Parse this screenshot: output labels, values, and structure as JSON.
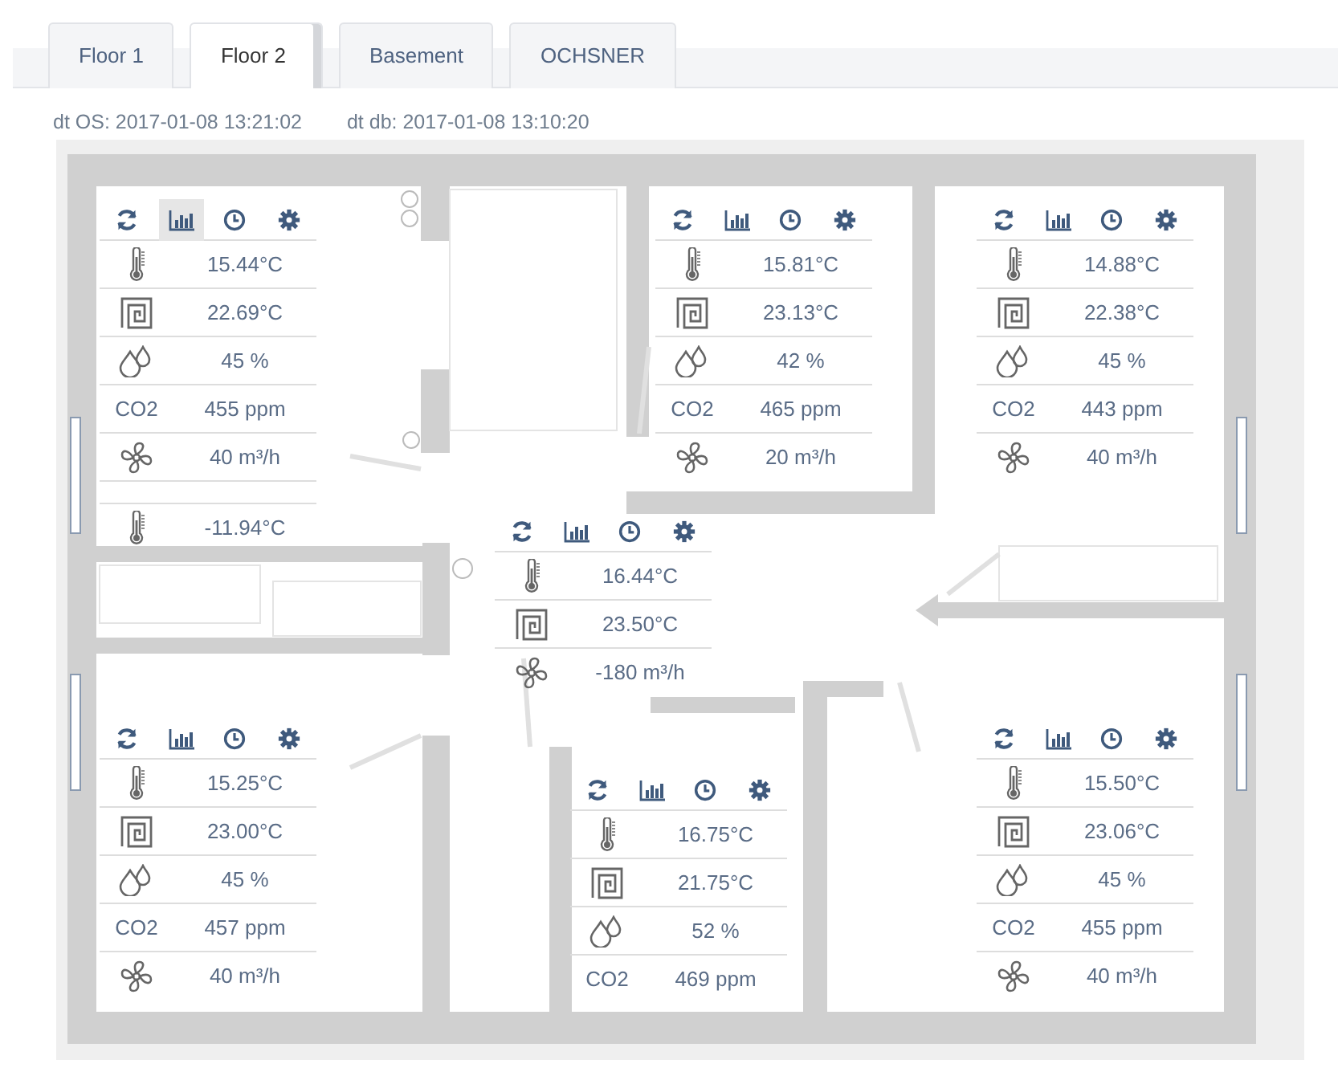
{
  "tabs": [
    {
      "label": "Floor 1",
      "selected": false
    },
    {
      "label": "Floor 2",
      "selected": true
    },
    {
      "label": "Basement",
      "selected": false
    },
    {
      "label": "OCHSNER",
      "selected": false
    }
  ],
  "timestamps": [
    "dt OS: 2017-01-08 13:21:02",
    "dt db: 2017-01-08 13:10:20"
  ],
  "rooms": [
    {
      "chart_highlighted": true,
      "rows": [
        {
          "kind": "temperature",
          "value": "15.44°C"
        },
        {
          "kind": "floor",
          "value": "22.69°C"
        },
        {
          "kind": "humidity",
          "value": "45 %"
        },
        {
          "kind": "co2",
          "label": "CO2",
          "value": "455 ppm"
        },
        {
          "kind": "fan",
          "value": "40 m³/h"
        },
        {
          "kind": "gap"
        },
        {
          "kind": "temperature",
          "value": "-11.94°C"
        }
      ]
    },
    {
      "chart_highlighted": false,
      "rows": [
        {
          "kind": "temperature",
          "value": "15.81°C"
        },
        {
          "kind": "floor",
          "value": "23.13°C"
        },
        {
          "kind": "humidity",
          "value": "42 %"
        },
        {
          "kind": "co2",
          "label": "CO2",
          "value": "465 ppm"
        },
        {
          "kind": "fan",
          "value": "20 m³/h"
        }
      ]
    },
    {
      "chart_highlighted": false,
      "rows": [
        {
          "kind": "temperature",
          "value": "14.88°C"
        },
        {
          "kind": "floor",
          "value": "22.38°C"
        },
        {
          "kind": "humidity",
          "value": "45 %"
        },
        {
          "kind": "co2",
          "label": "CO2",
          "value": "443 ppm"
        },
        {
          "kind": "fan",
          "value": "40 m³/h"
        }
      ]
    },
    {
      "chart_highlighted": false,
      "rows": [
        {
          "kind": "temperature",
          "value": "16.44°C"
        },
        {
          "kind": "floor",
          "value": "23.50°C"
        },
        {
          "kind": "fan",
          "value": "-180 m³/h"
        }
      ]
    },
    {
      "chart_highlighted": false,
      "rows": [
        {
          "kind": "temperature",
          "value": "15.25°C"
        },
        {
          "kind": "floor",
          "value": "23.00°C"
        },
        {
          "kind": "humidity",
          "value": "45 %"
        },
        {
          "kind": "co2",
          "label": "CO2",
          "value": "457 ppm"
        },
        {
          "kind": "fan",
          "value": "40 m³/h"
        }
      ]
    },
    {
      "chart_highlighted": false,
      "rows": [
        {
          "kind": "temperature",
          "value": "16.75°C"
        },
        {
          "kind": "floor",
          "value": "21.75°C"
        },
        {
          "kind": "humidity",
          "value": "52 %"
        },
        {
          "kind": "co2",
          "label": "CO2",
          "value": "469 ppm"
        }
      ]
    },
    {
      "chart_highlighted": false,
      "rows": [
        {
          "kind": "temperature",
          "value": "15.50°C"
        },
        {
          "kind": "floor",
          "value": "23.06°C"
        },
        {
          "kind": "humidity",
          "value": "45 %"
        },
        {
          "kind": "co2",
          "label": "CO2",
          "value": "455 ppm"
        },
        {
          "kind": "fan",
          "value": "40 m³/h"
        }
      ]
    }
  ]
}
